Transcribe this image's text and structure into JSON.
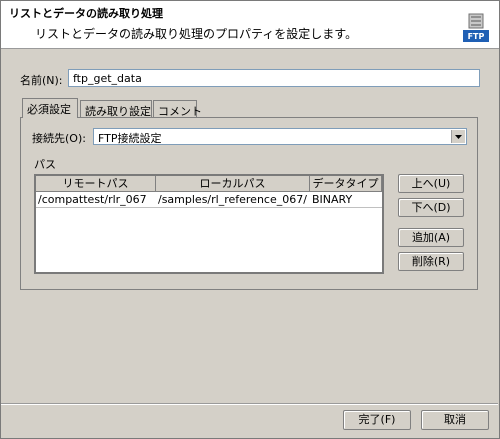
{
  "header": {
    "title": "リストとデータの読み取り処理",
    "description": "リストとデータの読み取り処理のプロパティを設定します。",
    "icon_label": "FTP"
  },
  "name_field": {
    "label": "名前(N):",
    "value": "ftp_get_data"
  },
  "tabs": [
    {
      "label": "必須設定"
    },
    {
      "label": "読み取り設定"
    },
    {
      "label": "コメント"
    }
  ],
  "connection": {
    "label": "接続先(O):",
    "selected": "FTP接続設定"
  },
  "path_section": {
    "label": "パス",
    "columns": [
      "リモートパス",
      "ローカルパス",
      "データタイプ"
    ],
    "rows": [
      [
        "/compattest/rlr_067",
        "/samples/rl_reference_067/",
        "BINARY"
      ]
    ]
  },
  "side_buttons": {
    "up": "上へ(U)",
    "down": "下へ(D)",
    "add": "追加(A)",
    "delete": "削除(R)"
  },
  "footer": {
    "finish": "完了(F)",
    "cancel": "取消"
  },
  "colors": {
    "background": "#d4d0c8",
    "header_bg": "#ffffff",
    "icon_blue": "#1f5fb4"
  }
}
